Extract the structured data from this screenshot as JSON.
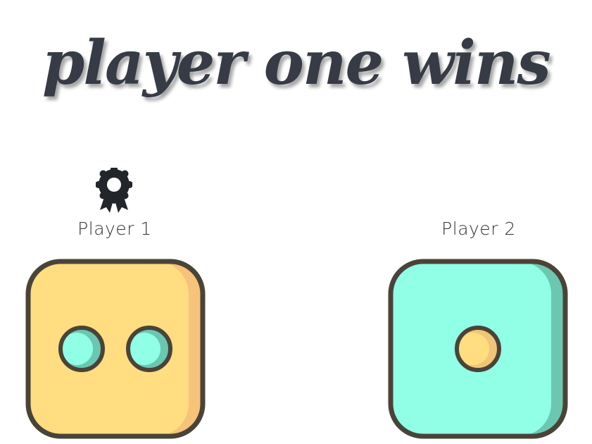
{
  "headline": "player one wins",
  "players": [
    {
      "label": "Player 1",
      "is_winner": true,
      "die_value": 2,
      "die_color": "#ffdd80",
      "die_shade": "#f7c27a",
      "pip_color": "#90ffe6",
      "pip_shade": "#69c8b2"
    },
    {
      "label": "Player 2",
      "is_winner": false,
      "die_value": 1,
      "die_color": "#90ffe6",
      "die_shade": "#6cc7b0",
      "pip_color": "#ffdd80",
      "pip_shade": "#f0c577"
    }
  ],
  "colors": {
    "outline": "#4a4338",
    "headline": "#363b45",
    "badge": "#22252a"
  },
  "icons": {
    "winner_badge": "award-ribbon-icon"
  }
}
